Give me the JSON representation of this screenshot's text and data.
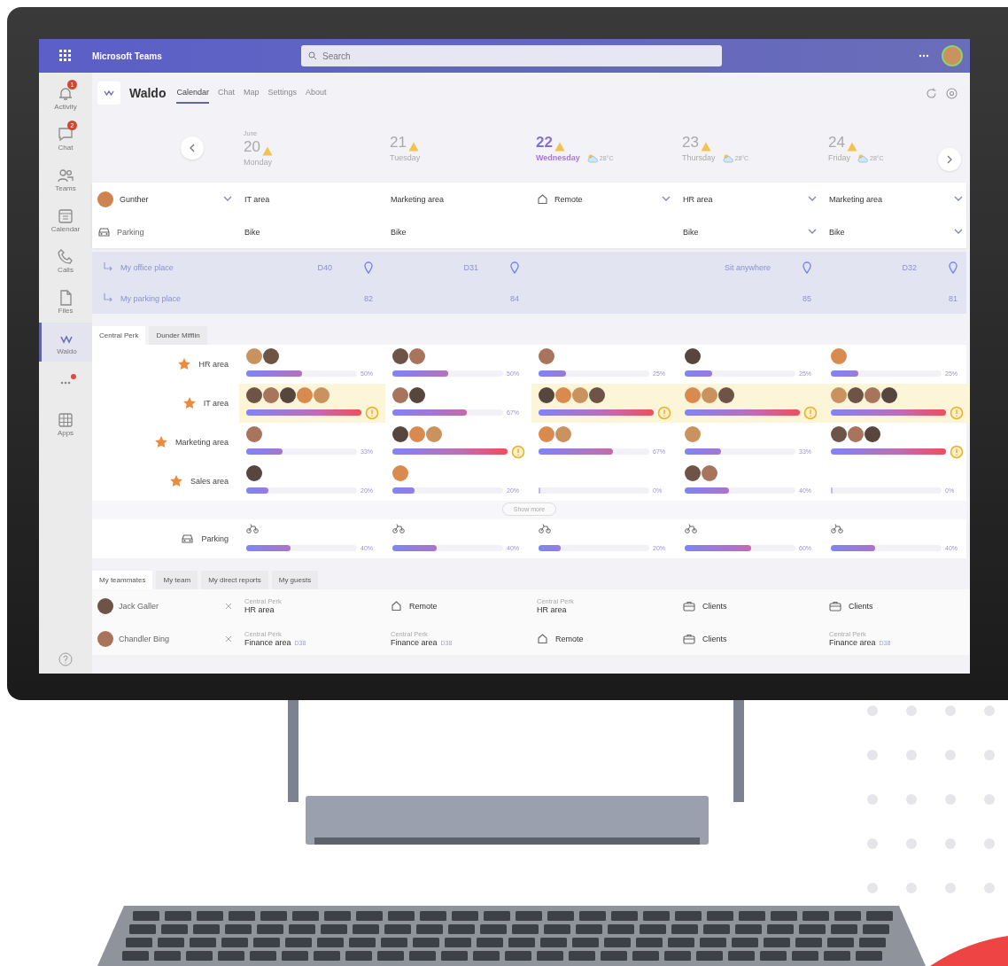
{
  "app_bar": {
    "title": "Microsoft Teams",
    "search": {
      "placeholder": "Search"
    }
  },
  "rail": [
    {
      "kind": "bell",
      "label": "Activity",
      "badge": "1",
      "selected": false
    },
    {
      "kind": "chat",
      "label": "Chat",
      "badge": "2",
      "selected": false
    },
    {
      "kind": "teams",
      "label": "Teams",
      "selected": false
    },
    {
      "kind": "calendar",
      "label": "Calendar",
      "selected": false
    },
    {
      "kind": "calls",
      "label": "Calls",
      "selected": false
    },
    {
      "kind": "files",
      "label": "Files",
      "selected": false
    },
    {
      "kind": "app",
      "label": "Waldo",
      "selected": true
    },
    {
      "kind": "more",
      "notification_dot": true,
      "selected": false
    },
    {
      "kind": "apps",
      "label": "Apps",
      "selected": false
    }
  ],
  "app": {
    "name": "Waldo",
    "tabs": [
      {
        "label": "Calendar",
        "selected": true
      },
      {
        "label": "Chat",
        "selected": false
      },
      {
        "label": "Map",
        "selected": false
      },
      {
        "label": "Settings",
        "selected": false
      },
      {
        "label": "About",
        "selected": false
      }
    ]
  },
  "days": [
    {
      "month": "June",
      "day": "20",
      "weekday": "Monday",
      "today": false
    },
    {
      "day": "21",
      "weekday": "Tuesday",
      "today": false
    },
    {
      "day": "22",
      "weekday": "Wednesday",
      "today": true,
      "weather": "28°C"
    },
    {
      "day": "23",
      "weekday": "Thursday",
      "today": false,
      "weather": "28°C"
    },
    {
      "day": "24",
      "weekday": "Friday",
      "today": false,
      "weather": "28°C"
    }
  ],
  "me": {
    "name": "Gunther",
    "parking_label": "Parking",
    "days": [
      {
        "kind": "area",
        "location": "IT area",
        "parking": "Bike",
        "editable": false,
        "office_place": "D40",
        "parking_place": "82"
      },
      {
        "kind": "area",
        "location": "Marketing area",
        "parking": "Bike",
        "editable": false,
        "office_place": "D31",
        "parking_place": "84"
      },
      {
        "kind": "remote",
        "location": "Remote",
        "editable": true
      },
      {
        "kind": "area",
        "location": "HR area",
        "parking": "Bike",
        "editable": true,
        "office_place": "Sit anywhere",
        "parking_place": "85"
      },
      {
        "kind": "area",
        "location": "Marketing area",
        "parking": "Bike",
        "editable": true,
        "office_place": "D32",
        "parking_place": "81"
      }
    ]
  },
  "places": [
    {
      "kind": "office",
      "label": "My office place"
    },
    {
      "kind": "parking",
      "label": "My parking place"
    }
  ],
  "location_tabs": [
    {
      "label": "Central Perk",
      "selected": true
    },
    {
      "label": "Dunder Mifflin",
      "selected": false
    }
  ],
  "areas": [
    {
      "name": "HR area",
      "favorite": true,
      "highlighted": false,
      "days": [
        {
          "avatars": [
            {
              "kind": "photo"
            },
            {
              "kind": "photo"
            }
          ],
          "level": 0.5,
          "reading": "50%",
          "warning": false
        },
        {
          "avatars": [
            {
              "kind": "photo"
            },
            {
              "kind": "photo"
            }
          ],
          "level": 0.5,
          "reading": "50%",
          "warning": false
        },
        {
          "avatars": [
            {
              "kind": "photo"
            }
          ],
          "level": 0.25,
          "reading": "25%",
          "warning": false
        },
        {
          "avatars": [
            {
              "kind": "photo"
            }
          ],
          "level": 0.25,
          "reading": "25%",
          "warning": false
        },
        {
          "avatars": [
            {
              "kind": "photo"
            }
          ],
          "level": 0.25,
          "reading": "25%",
          "warning": false
        }
      ]
    },
    {
      "name": "IT area",
      "favorite": true,
      "highlighted": true,
      "days": [
        {
          "avatars": [
            {
              "kind": "photo"
            },
            {
              "kind": "photo"
            },
            {
              "kind": "photo"
            },
            {
              "kind": "photo"
            },
            {
              "kind": "photo"
            }
          ],
          "level": 1,
          "warning": true
        },
        {
          "avatars": [
            {
              "kind": "photo"
            },
            {
              "kind": "photo"
            }
          ],
          "level": 0.67,
          "reading": "67%",
          "warning": false
        },
        {
          "avatars": [
            {
              "kind": "photo"
            },
            {
              "kind": "photo"
            },
            {
              "kind": "photo"
            },
            {
              "kind": "photo"
            }
          ],
          "level": 1,
          "warning": true
        },
        {
          "avatars": [
            {
              "kind": "photo"
            },
            {
              "kind": "photo"
            },
            {
              "kind": "photo"
            }
          ],
          "level": 1,
          "warning": true
        },
        {
          "avatars": [
            {
              "kind": "photo"
            },
            {
              "kind": "photo"
            },
            {
              "kind": "photo"
            },
            {
              "kind": "photo"
            }
          ],
          "level": 1,
          "warning": true
        }
      ]
    },
    {
      "name": "Marketing area",
      "favorite": true,
      "highlighted": false,
      "days": [
        {
          "avatars": [
            {
              "kind": "photo"
            }
          ],
          "level": 0.33,
          "reading": "33%",
          "warning": false
        },
        {
          "avatars": [
            {
              "kind": "photo"
            },
            {
              "kind": "photo"
            },
            {
              "kind": "photo"
            }
          ],
          "level": 1,
          "warning": true
        },
        {
          "avatars": [
            {
              "kind": "photo"
            },
            {
              "kind": "photo"
            }
          ],
          "level": 0.67,
          "reading": "67%",
          "warning": false
        },
        {
          "avatars": [
            {
              "kind": "photo"
            }
          ],
          "level": 0.33,
          "reading": "33%",
          "warning": false
        },
        {
          "avatars": [
            {
              "kind": "photo"
            },
            {
              "kind": "photo"
            },
            {
              "kind": "photo"
            }
          ],
          "level": 1,
          "warning": true
        }
      ]
    },
    {
      "name": "Sales area",
      "favorite": true,
      "highlighted": false,
      "days": [
        {
          "avatars": [
            {
              "kind": "photo"
            }
          ],
          "level": 0.2,
          "reading": "20%",
          "warning": false
        },
        {
          "avatars": [
            {
              "kind": "photo"
            }
          ],
          "level": 0.2,
          "reading": "20%",
          "warning": false
        },
        {
          "level": 0,
          "reading": "0%",
          "warning": false
        },
        {
          "avatars": [
            {
              "kind": "photo"
            },
            {
              "kind": "photo"
            }
          ],
          "level": 0.4,
          "reading": "40%",
          "warning": false
        },
        {
          "level": 0,
          "reading": "0%",
          "warning": false
        }
      ]
    }
  ],
  "show_more": "Show more",
  "parking": {
    "label": "Parking",
    "days": [
      {
        "level": 0.4,
        "reading": "40%"
      },
      {
        "level": 0.4,
        "reading": "40%"
      },
      {
        "level": 0.2,
        "reading": "20%"
      },
      {
        "level": 0.6,
        "reading": "60%"
      },
      {
        "level": 0.4,
        "reading": "40%"
      }
    ]
  },
  "team_tabs": [
    {
      "label": "My teammates",
      "selected": true
    },
    {
      "label": "My team",
      "selected": false
    },
    {
      "label": "My direct reports",
      "selected": false
    },
    {
      "label": "My guests",
      "selected": false
    }
  ],
  "teammates": [
    {
      "name": "Jack Galler",
      "days": [
        {
          "kind": "office",
          "caption": "Central Perk",
          "text": "HR area"
        },
        {
          "kind": "remote",
          "text": "Remote"
        },
        {
          "kind": "office",
          "caption": "Central Perk",
          "text": "HR area"
        },
        {
          "kind": "clients",
          "text": "Clients"
        },
        {
          "kind": "clients",
          "text": "Clients"
        }
      ]
    },
    {
      "name": "Chandler Bing",
      "days": [
        {
          "kind": "office",
          "caption": "Central Perk",
          "text": "Finance area",
          "desk": "D38"
        },
        {
          "kind": "office",
          "caption": "Central Perk",
          "text": "Finance area",
          "desk": "D38"
        },
        {
          "kind": "remote",
          "text": "Remote"
        },
        {
          "kind": "clients",
          "text": "Clients"
        },
        {
          "kind": "office",
          "caption": "Central Perk",
          "text": "Finance area",
          "desk": "D38"
        }
      ]
    }
  ]
}
